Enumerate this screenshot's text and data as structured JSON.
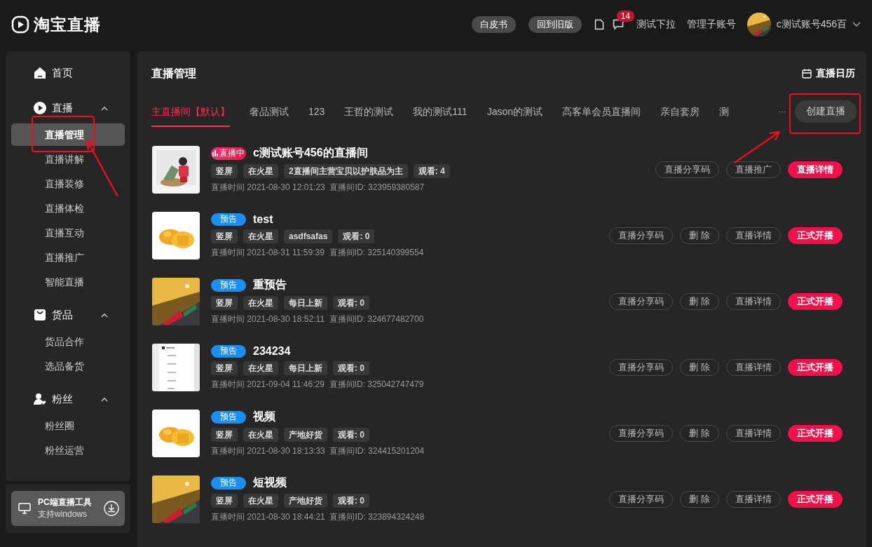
{
  "header": {
    "logo": "淘宝直播",
    "buttons": [
      "白皮书",
      "回到旧版"
    ],
    "message_count": "14",
    "links": [
      "测试下拉",
      "管理子账号"
    ],
    "account": "c测试账号456百"
  },
  "sidebar": {
    "groups": [
      {
        "label": "首页",
        "kind": "link"
      },
      {
        "label": "直播",
        "kind": "section",
        "expanded": true,
        "children": [
          {
            "label": "直播管理",
            "selected": true
          },
          {
            "label": "直播讲解",
            "selected": false
          },
          {
            "label": "直播装修",
            "selected": false
          },
          {
            "label": "直播体检",
            "selected": false
          },
          {
            "label": "直播互动",
            "selected": false
          },
          {
            "label": "直播推广",
            "selected": false
          },
          {
            "label": "智能直播",
            "selected": false
          }
        ]
      },
      {
        "label": "货品",
        "kind": "section",
        "expanded": true,
        "children": [
          {
            "label": "货品合作",
            "selected": false
          },
          {
            "label": "选品备货",
            "selected": false
          }
        ]
      },
      {
        "label": "粉丝",
        "kind": "section",
        "expanded": true,
        "children": [
          {
            "label": "粉丝圈",
            "selected": false
          },
          {
            "label": "粉丝运营",
            "selected": false
          }
        ]
      }
    ],
    "pc_tool": {
      "title": "PC端直播工具",
      "subtitle": "支持windows"
    }
  },
  "main": {
    "title": "直播管理",
    "calendar": "直播日历",
    "tabs": [
      {
        "label": "主直播间【默认】",
        "selected": true
      },
      {
        "label": "奢品测试",
        "selected": false
      },
      {
        "label": "123",
        "selected": false
      },
      {
        "label": "王哲的测试",
        "selected": false
      },
      {
        "label": "我的测试111",
        "selected": false
      },
      {
        "label": "Jason的测试",
        "selected": false
      },
      {
        "label": "高客单会员直播间",
        "selected": false
      },
      {
        "label": "亲自套房",
        "selected": false
      },
      {
        "label": "测",
        "selected": false
      }
    ],
    "more": "···",
    "create_button": "创建直播",
    "rows": [
      {
        "kind": "live",
        "status": "直播中",
        "title": "c测试账号456的直播间",
        "tags": [
          "竖屏",
          "在火星",
          "2直播间主营宝贝以护肤品为主",
          "观看: 4"
        ],
        "time": "直播时间 2021-08-30 12:01:23",
        "room_id": "直播间ID: 323959380587",
        "actions": [
          {
            "label": "直播分享码",
            "primary": false
          },
          {
            "label": "直播推广",
            "primary": false
          },
          {
            "label": "直播详情",
            "primary": true
          }
        ]
      },
      {
        "kind": "preview",
        "status": "预告",
        "title": "test",
        "tags": [
          "竖屏",
          "在火星",
          "asdfsafas",
          "观看: 0"
        ],
        "time": "直播时间 2021-08-31 11:59:39",
        "room_id": "直播间ID: 325140399554",
        "actions": [
          {
            "label": "直播分享码",
            "primary": false
          },
          {
            "label": "删 除",
            "primary": false
          },
          {
            "label": "直播详情",
            "primary": false
          },
          {
            "label": "正式开播",
            "primary": true
          }
        ]
      },
      {
        "kind": "preview",
        "status": "预告",
        "title": "重预告",
        "tags": [
          "竖屏",
          "在火星",
          "每日上新",
          "观看: 0"
        ],
        "time": "直播时间 2021-08-30 18:52:11",
        "room_id": "直播间ID: 324677482700",
        "actions": [
          {
            "label": "直播分享码",
            "primary": false
          },
          {
            "label": "删 除",
            "primary": false
          },
          {
            "label": "直播详情",
            "primary": false
          },
          {
            "label": "正式开播",
            "primary": true
          }
        ]
      },
      {
        "kind": "preview",
        "status": "预告",
        "title": "234234",
        "tags": [
          "竖屏",
          "在火星",
          "每日上新",
          "观看: 0"
        ],
        "time": "直播时间 2021-09-04 11:46:29",
        "room_id": "直播间ID: 325042747479",
        "actions": [
          {
            "label": "直播分享码",
            "primary": false
          },
          {
            "label": "删 除",
            "primary": false
          },
          {
            "label": "直播详情",
            "primary": false
          },
          {
            "label": "正式开播",
            "primary": true
          }
        ]
      },
      {
        "kind": "preview",
        "status": "预告",
        "title": "视频",
        "tags": [
          "竖屏",
          "在火星",
          "产地好货",
          "观看: 0"
        ],
        "time": "直播时间 2021-08-30 18:13:33",
        "room_id": "直播间ID: 324415201204",
        "actions": [
          {
            "label": "直播分享码",
            "primary": false
          },
          {
            "label": "删 除",
            "primary": false
          },
          {
            "label": "直播详情",
            "primary": false
          },
          {
            "label": "正式开播",
            "primary": true
          }
        ]
      },
      {
        "kind": "preview",
        "status": "预告",
        "title": "短视频",
        "tags": [
          "竖屏",
          "在火星",
          "产地好货",
          "观看: 0"
        ],
        "time": "直播时间 2021-08-30 18:44:21",
        "room_id": "直播间ID: 323894324248",
        "actions": [
          {
            "label": "直播分享码",
            "primary": false
          },
          {
            "label": "删 除",
            "primary": false
          },
          {
            "label": "直播详情",
            "primary": false
          },
          {
            "label": "正式开播",
            "primary": true
          }
        ]
      }
    ]
  }
}
